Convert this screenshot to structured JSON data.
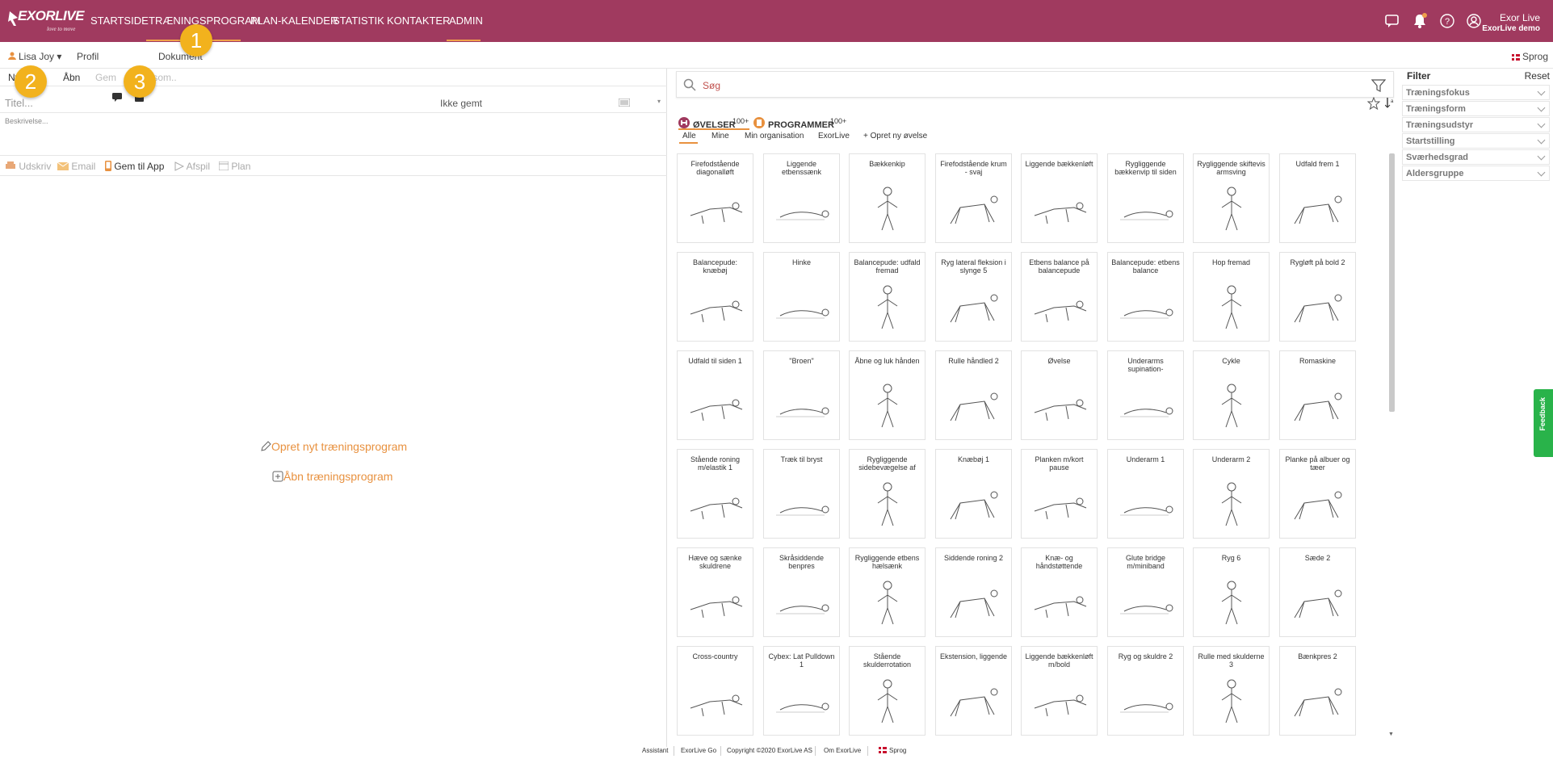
{
  "app": {
    "logo": "EXORLIVE",
    "tagline": "love to move"
  },
  "nav": {
    "items": [
      {
        "label": "STARTSIDE"
      },
      {
        "label": "TRÆNINGSPROGRAM"
      },
      {
        "label": "PLAN-KALENDER"
      },
      {
        "label": "STATISTIK"
      },
      {
        "label": "KONTAKTER"
      },
      {
        "label": "ADMIN"
      }
    ],
    "active": "TRÆNINGSPROGRAM",
    "accent": "#f0a04b",
    "bar_color": "#a03a5f"
  },
  "user": {
    "name": "Exor Live",
    "org": "ExorLive demo",
    "notification_dot": "#f0a04b"
  },
  "secondbar": {
    "client": "Lisa Joy",
    "profile": "Profil",
    "document": "Dokument",
    "language": "Sprog"
  },
  "badges": [
    "1",
    "2",
    "3"
  ],
  "program": {
    "toolbar": {
      "new": "Ny",
      "open": "Åbn",
      "save": "Gem",
      "save_as": "Gem som.."
    },
    "title_placeholder": "Titel...",
    "status": "Ikke gemt",
    "description_placeholder": "Beskrivelse...",
    "actions": {
      "print": "Udskriv",
      "email": "Email",
      "save_app": "Gem til App",
      "play": "Afspil",
      "plan": "Plan"
    },
    "create_new": "Opret nyt træningsprogram",
    "open_program": "Åbn træningsprogram"
  },
  "search": {
    "placeholder": "Søg"
  },
  "library": {
    "tab_exercises": "ØVELSER",
    "tab_exercises_count": "100+",
    "tab_programs": "PROGRAMMER",
    "tab_programs_count": "100+",
    "subtabs": [
      "Alle",
      "Mine",
      "Min organisation",
      "ExorLive",
      "+ Opret ny øvelse"
    ],
    "exercises": [
      "Firefodstående diagonalløft",
      "Liggende etbenssænk",
      "Bækkenkip",
      "Firefodstående krum - svaj",
      "Liggende bækkenløft",
      "Rygliggende bækkenvip til siden",
      "Rygliggende skiftevis armsving",
      "Udfald frem 1",
      "Balancepude: knæbøj",
      "Hinke",
      "Balancepude: udfald fremad",
      "Ryg lateral fleksion i slynge 5",
      "Etbens balance på balancepude",
      "Balancepude: etbens balance",
      "Hop fremad",
      "Rygløft på bold 2",
      "Udfald til siden 1",
      "\"Broen\"",
      "Åbne og luk hånden",
      "Rulle håndled 2",
      "Øvelse",
      "Underarms supination-",
      "Cykle",
      "Romaskine",
      "Stående roning m/elastik 1",
      "Træk til bryst",
      "Rygliggende sidebevægelse af",
      "Knæbøj 1",
      "Planken m/kort pause",
      "Underarm 1",
      "Underarm 2",
      "Planke på albuer og tæer",
      "Hæve og sænke skuldrene",
      "Skråsiddende benpres",
      "Rygliggende etbens hælsænk",
      "Siddende roning 2",
      "Knæ- og håndstøttende",
      "Glute bridge m/miniband",
      "Ryg 6",
      "Sæde 2",
      "Cross-country",
      "Cybex: Lat Pulldown 1",
      "Stående skulderrotation",
      "Ekstension, liggende",
      "Liggende bækkenløft m/bold",
      "Ryg og skuldre 2",
      "Rulle med skulderne 3",
      "Bænkpres 2"
    ]
  },
  "filter": {
    "title": "Filter",
    "reset": "Reset",
    "groups": [
      "Træningsfokus",
      "Træningsform",
      "Træningsudstyr",
      "Startstilling",
      "Sværhedsgrad",
      "Aldersgruppe"
    ]
  },
  "feedback": "Feedback",
  "footer": {
    "assistant": "Assistant",
    "go": "ExorLive Go",
    "copyright": "Copyright ©2020 ExorLive AS",
    "about": "Om ExorLive",
    "language": "Sprog"
  }
}
